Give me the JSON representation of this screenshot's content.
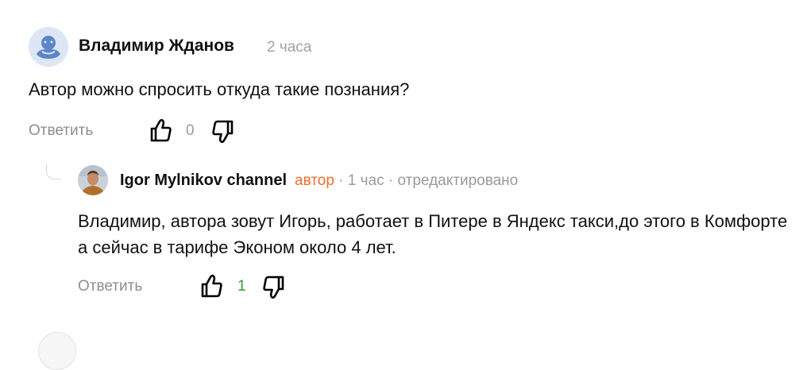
{
  "comment": {
    "author": "Владимир Жданов",
    "time": "2 часа",
    "text": "Автор можно спросить откуда такие познания?",
    "reply_label": "Ответить",
    "likes": "0"
  },
  "reply": {
    "author": "Igor Mylnikov channel",
    "badge": "автор",
    "meta": " · 1 час · отредактировано",
    "text": "Владимир, автора зовут Игорь, работает в Питере в Яндекс такси,до этого в Комфорте а сейчас в тарифе Эконом около 4 лет.",
    "reply_label": "Ответить",
    "likes": "1"
  },
  "colors": {
    "accent_author": "#ee6f2d",
    "likes_positive": "#2e9b39",
    "muted": "#9a9a9a"
  },
  "icons": [
    "default-avatar-icon",
    "thumbs-up-icon",
    "thumbs-down-icon",
    "user-photo-avatar"
  ]
}
